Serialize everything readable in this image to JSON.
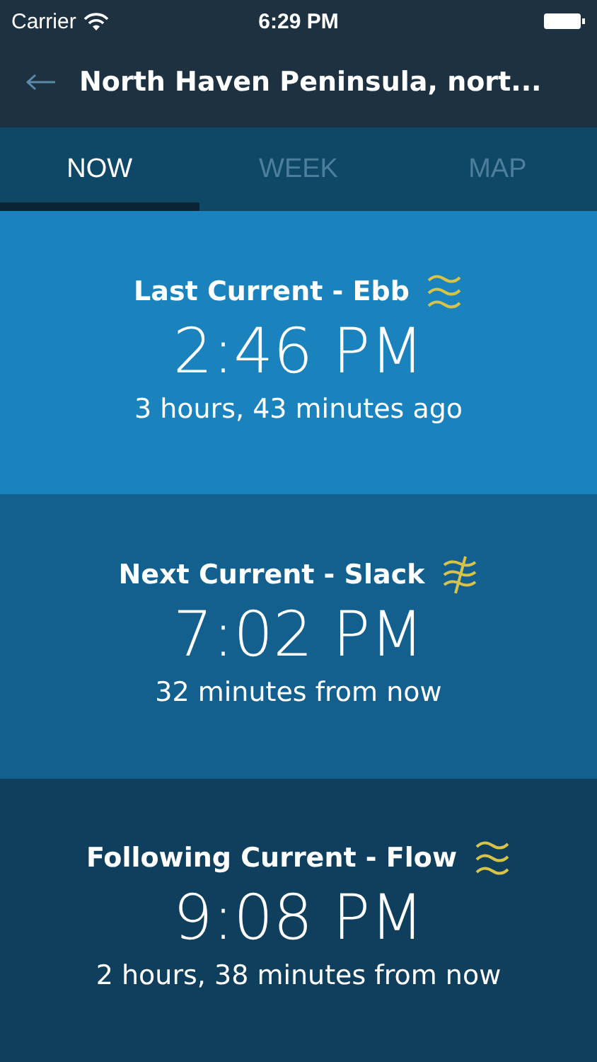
{
  "status_bar": {
    "carrier": "Carrier",
    "time": "6:29 PM"
  },
  "header": {
    "title": "North Haven Peninsula, nort..."
  },
  "tabs": [
    {
      "label": "NOW",
      "selected": true
    },
    {
      "label": "WEEK",
      "selected": false
    },
    {
      "label": "MAP",
      "selected": false
    }
  ],
  "currents": [
    {
      "title": "Last Current - Ebb",
      "kind": "waves",
      "time": "2:46 PM",
      "relative": "3 hours, 43 minutes ago"
    },
    {
      "title": "Next Current - Slack",
      "kind": "slack",
      "time": "7:02 PM",
      "relative": "32 minutes from now"
    },
    {
      "title": "Following Current - Flow",
      "kind": "waves",
      "time": "9:08 PM",
      "relative": "2 hours, 38 minutes from now"
    }
  ]
}
